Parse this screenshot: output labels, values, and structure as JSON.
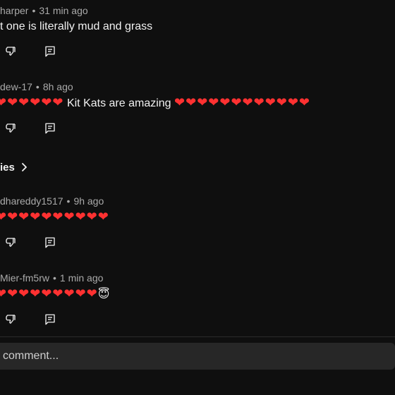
{
  "comments": [
    {
      "author": "harper",
      "time": "31 min ago",
      "text": "t one is literally mud and grass",
      "hearts_before": "",
      "hearts_after": ""
    },
    {
      "author": "dew-17",
      "time": "8h ago",
      "hearts_before": "❤❤❤❤❤❤",
      "text": "Kit Kats are amazing",
      "hearts_after": "❤❤❤❤❤❤❤❤❤❤❤❤"
    },
    {
      "author": "dhareddy1517",
      "time": "9h ago",
      "hearts_before": "❤❤❤❤❤❤❤❤❤❤",
      "text": "",
      "hearts_after": ""
    },
    {
      "author": "Mier-fm5rw",
      "time": "1 min ago",
      "hearts_before": "❤❤❤❤❤❤❤❤❤",
      "text": "😇",
      "hearts_after": ""
    }
  ],
  "replies_label": "ies",
  "composer": {
    "placeholder": "comment..."
  },
  "icons": {
    "dislike": "thumbs-down-icon",
    "reply": "reply-comment-icon",
    "chevron": "chevron-right-icon"
  },
  "colors": {
    "background": "#0f0f0f",
    "heart": "#ff3131",
    "meta_text": "#aaaaaa",
    "composer_bg": "#272727"
  }
}
